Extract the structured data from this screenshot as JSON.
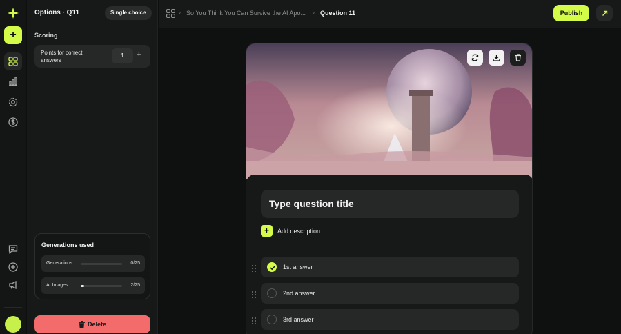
{
  "options": {
    "title": "Options · Q11",
    "type_chip": "Single choice",
    "scoring_label": "Scoring",
    "points_label": "Points for correct answers",
    "points_value": "1",
    "generations": {
      "title": "Generations used",
      "rows": [
        {
          "name": "Generations",
          "count": "0/25",
          "fraction": 0.0
        },
        {
          "name": "AI Images",
          "count": "2/25",
          "fraction": 0.08
        }
      ]
    },
    "delete_label": "Delete"
  },
  "topbar": {
    "breadcrumb_parent": "So You Think You Can Survive the AI Apo...",
    "breadcrumb_current": "Question 11",
    "publish_label": "Publish"
  },
  "editor": {
    "title_placeholder": "Type question title",
    "add_description_label": "Add description",
    "answers": [
      {
        "label": "1st answer",
        "correct": true
      },
      {
        "label": "2nd answer",
        "correct": false
      },
      {
        "label": "3rd answer",
        "correct": false
      }
    ]
  },
  "colors": {
    "accent": "#d4fb47",
    "danger": "#f36b6b"
  }
}
